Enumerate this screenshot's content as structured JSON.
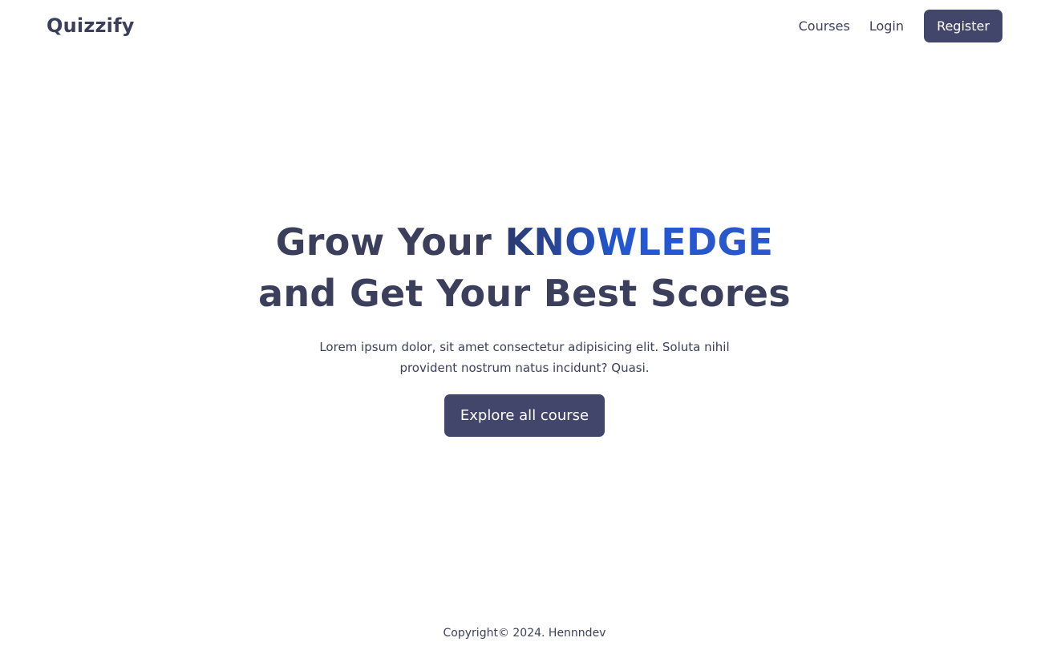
{
  "header": {
    "brand": "Quizzify",
    "nav": {
      "courses": "Courses",
      "login": "Login",
      "register": "Register"
    }
  },
  "hero": {
    "title_part1": "Grow Your ",
    "title_highlight": "KNOWLEDGE",
    "title_line2": "and Get Your Best Scores",
    "description": "Lorem ipsum dolor, sit amet consectetur adipisicing elit. Soluta nihil provident nostrum natus incidunt? Quasi.",
    "cta_label": "Explore all course"
  },
  "footer": {
    "copyright": "Copyright© 2024. Hennndev"
  },
  "colors": {
    "primary": "#43466b",
    "text": "#3b3f5c",
    "highlight_start": "#2b3a6e",
    "highlight_end": "#2357d6",
    "background": "#ffffff"
  }
}
